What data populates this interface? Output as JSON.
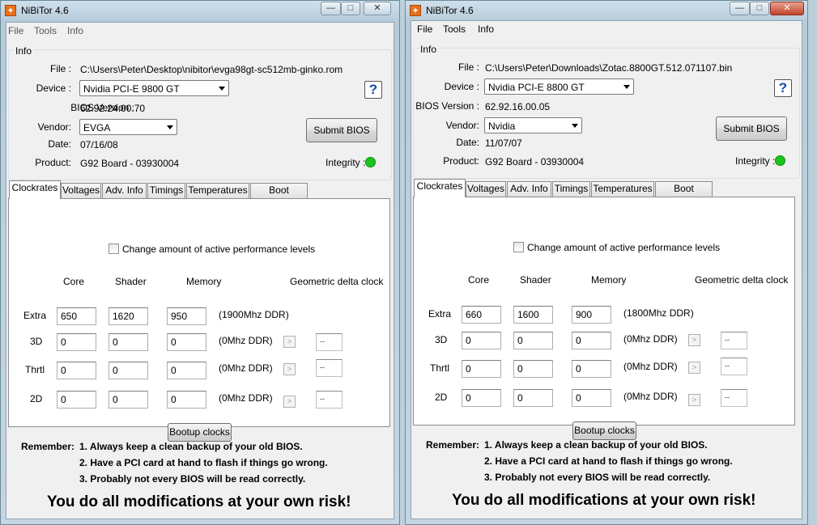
{
  "windows": [
    {
      "title": "NiBiTor 4.6",
      "menu": [
        "File",
        "Tools",
        "Info"
      ],
      "info_group": "Info",
      "labels": {
        "file": "File :",
        "device": "Device :",
        "bios": "BIOS Version :",
        "vendor": "Vendor:",
        "date": "Date:",
        "product": "Product:",
        "integrity": "Integrity :"
      },
      "file": "C:\\Users\\Peter\\Desktop\\nibitor\\evga98gt-sc512mb-ginko.rom",
      "device": "Nvidia PCI-E 9800 GT",
      "bios_version": "62.92.24.00.70",
      "vendor": "EVGA",
      "date": "07/16/08",
      "product": "G92 Board - 03930004",
      "help": "?",
      "submit_bios": "Submit BIOS",
      "tabs": [
        "Clockrates",
        "Voltages",
        "Adv. Info",
        "Timings",
        "Temperatures",
        "Boot Settings"
      ],
      "perf_checkbox": "Change amount of active performance levels",
      "columns": {
        "core": "Core",
        "shader": "Shader",
        "memory": "Memory",
        "delta": "Geometric delta clock"
      },
      "rows": [
        {
          "label": "Extra",
          "core": "650",
          "shader": "1620",
          "memory": "950",
          "ddr": "(1900Mhz DDR)"
        },
        {
          "label": "3D",
          "core": "0",
          "shader": "0",
          "memory": "0",
          "ddr": "(0Mhz DDR)",
          "delta": "--"
        },
        {
          "label": "Thrtl",
          "core": "0",
          "shader": "0",
          "memory": "0",
          "ddr": "(0Mhz DDR)",
          "delta": "--"
        },
        {
          "label": "2D",
          "core": "0",
          "shader": "0",
          "memory": "0",
          "ddr": "(0Mhz DDR)",
          "delta": "--"
        }
      ],
      "bootup_clocks": "Bootup clocks",
      "remember_label": "Remember:",
      "remember_items": [
        "1. Always keep a clean backup of your old BIOS.",
        "2. Have a PCI card at hand to flash if things go wrong.",
        "3. Probably not every BIOS will be read correctly."
      ],
      "risk": "You do all modifications at your own risk!"
    },
    {
      "title": "NiBiTor 4.6",
      "menu": [
        "File",
        "Tools",
        "Info"
      ],
      "info_group": "Info",
      "labels": {
        "file": "File :",
        "device": "Device :",
        "bios": "BIOS Version :",
        "vendor": "Vendor:",
        "date": "Date:",
        "product": "Product:",
        "integrity": "Integrity :"
      },
      "file": "C:\\Users\\Peter\\Downloads\\Zotac.8800GT.512.071107.bin",
      "device": "Nvidia PCI-E 8800 GT",
      "bios_version": "62.92.16.00.05",
      "vendor": "Nvidia",
      "date": "11/07/07",
      "product": "G92 Board - 03930004",
      "help": "?",
      "submit_bios": "Submit BIOS",
      "tabs": [
        "Clockrates",
        "Voltages",
        "Adv. Info",
        "Timings",
        "Temperatures",
        "Boot Settings"
      ],
      "perf_checkbox": "Change amount of active performance levels",
      "columns": {
        "core": "Core",
        "shader": "Shader",
        "memory": "Memory",
        "delta": "Geometric delta clock"
      },
      "rows": [
        {
          "label": "Extra",
          "core": "660",
          "shader": "1600",
          "memory": "900",
          "ddr": "(1800Mhz DDR)"
        },
        {
          "label": "3D",
          "core": "0",
          "shader": "0",
          "memory": "0",
          "ddr": "(0Mhz DDR)",
          "delta": "--"
        },
        {
          "label": "Thrtl",
          "core": "0",
          "shader": "0",
          "memory": "0",
          "ddr": "(0Mhz DDR)",
          "delta": "--"
        },
        {
          "label": "2D",
          "core": "0",
          "shader": "0",
          "memory": "0",
          "ddr": "(0Mhz DDR)",
          "delta": "--"
        }
      ],
      "bootup_clocks": "Bootup clocks",
      "remember_label": "Remember:",
      "remember_items": [
        "1. Always keep a clean backup of your old BIOS.",
        "2. Have a PCI card at hand to flash if things go wrong.",
        "3. Probably not every BIOS will be read correctly."
      ],
      "risk": "You do all modifications at your own risk!"
    }
  ],
  "colors": {
    "integrity_ok": "#19c41d",
    "help_glyph": "#1848a8"
  }
}
